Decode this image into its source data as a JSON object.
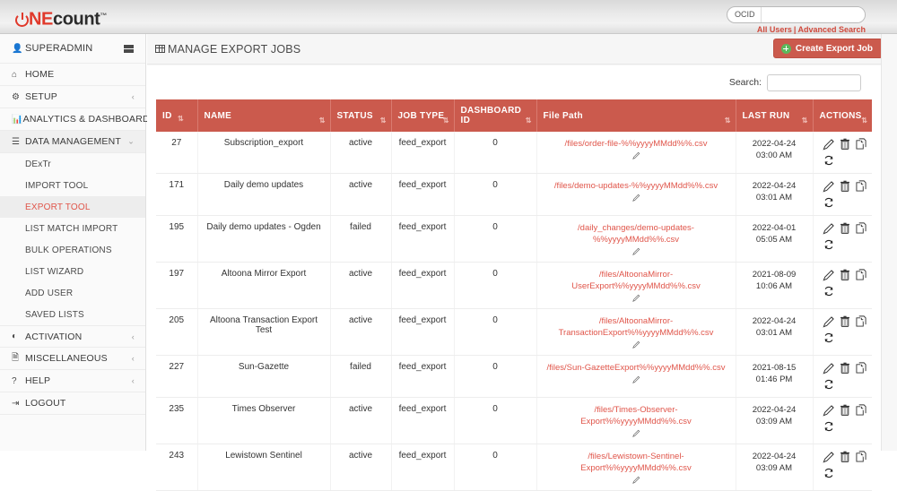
{
  "brand": {
    "logo_one": "NE",
    "logo_count": "count",
    "logo_tm": "™"
  },
  "topbar": {
    "search_label": "OCID",
    "search_value": "",
    "search_placeholder": "",
    "search_icon": "search-icon",
    "link_all_users": "All Users",
    "link_separator": "|",
    "link_advanced_search": "Advanced Search"
  },
  "sidebar": {
    "user": "SUPERADMIN",
    "items": [
      {
        "label": "HOME",
        "icon": "home-icon",
        "glyph": "⌂",
        "caret": ""
      },
      {
        "label": "SETUP",
        "icon": "gear-icon",
        "glyph": "⚙",
        "caret": "‹"
      },
      {
        "label": "ANALYTICS & DASHBOARD",
        "icon": "chart-icon",
        "glyph": "Ὄa",
        "caret": "‹"
      },
      {
        "label": "DATA MANAGEMENT",
        "icon": "database-icon",
        "glyph": "☰",
        "caret": "⌄"
      }
    ],
    "sub_items": [
      "DExTr",
      "IMPORT TOOL",
      "EXPORT TOOL",
      "LIST MATCH IMPORT",
      "BULK OPERATIONS",
      "LIST WIZARD",
      "ADD USER",
      "SAVED LISTS"
    ],
    "selected_sub": "EXPORT TOOL",
    "bottom_items": [
      {
        "label": "ACTIVATION",
        "icon": "toggle-icon",
        "glyph": "◐",
        "caret": "‹"
      },
      {
        "label": "MISCELLANEOUS",
        "icon": "file-icon",
        "glyph": "☐",
        "caret": "‹"
      },
      {
        "label": "HELP",
        "icon": "question-icon",
        "glyph": "?",
        "caret": "‹"
      },
      {
        "label": "LOGOUT",
        "icon": "logout-icon",
        "glyph": "⇥",
        "caret": ""
      }
    ]
  },
  "page": {
    "title": "MANAGE EXPORT JOBS",
    "title_icon": "table-icon",
    "create_button": "Create Export Job",
    "create_button_icon": "plus-circle-icon",
    "table_search_label": "Search:",
    "table_search_value": "",
    "table_search_placeholder": ""
  },
  "table": {
    "columns": [
      {
        "key": "id",
        "label": "ID"
      },
      {
        "key": "name",
        "label": "NAME"
      },
      {
        "key": "status",
        "label": "STATUS"
      },
      {
        "key": "job_type",
        "label": "JOB TYPE"
      },
      {
        "key": "dashboard_id",
        "label": "DASHBOARD ID"
      },
      {
        "key": "file_path",
        "label": "File Path"
      },
      {
        "key": "last_run",
        "label": "LAST RUN"
      },
      {
        "key": "actions",
        "label": "ACTIONS"
      }
    ],
    "sort_icon": "⇅",
    "row_action_icons": [
      "edit-icon",
      "delete-icon",
      "copy-icon",
      "run-icon"
    ],
    "rows": [
      {
        "id": "27",
        "name": "Subscription_export",
        "status": "active",
        "job_type": "feed_export",
        "dashboard_id": "0",
        "file_path": "/files/order-file-%%yyyyMMdd%%.csv",
        "last_run": "2022-04-24 03:00 AM"
      },
      {
        "id": "171",
        "name": "Daily demo updates",
        "status": "active",
        "job_type": "feed_export",
        "dashboard_id": "0",
        "file_path": "/files/demo-updates-%%yyyyMMdd%%.csv",
        "last_run": "2022-04-24 03:01 AM"
      },
      {
        "id": "195",
        "name": "Daily demo updates - Ogden",
        "status": "failed",
        "job_type": "feed_export",
        "dashboard_id": "0",
        "file_path": "/daily_changes/demo-updates-%%yyyyMMdd%%.csv",
        "last_run": "2022-04-01 05:05 AM"
      },
      {
        "id": "197",
        "name": "Altoona Mirror Export",
        "status": "active",
        "job_type": "feed_export",
        "dashboard_id": "0",
        "file_path": "/files/AltoonaMirror-UserExport%%yyyyMMdd%%.csv",
        "last_run": "2021-08-09 10:06 AM"
      },
      {
        "id": "205",
        "name": "Altoona Transaction Export Test",
        "status": "active",
        "job_type": "feed_export",
        "dashboard_id": "0",
        "file_path": "/files/AltoonaMirror-TransactionExport%%yyyyMMdd%%.csv",
        "last_run": "2022-04-24 03:01 AM"
      },
      {
        "id": "227",
        "name": "Sun-Gazette",
        "status": "failed",
        "job_type": "feed_export",
        "dashboard_id": "0",
        "file_path": "/files/Sun-GazetteExport%%yyyyMMdd%%.csv",
        "last_run": "2021-08-15 01:46 PM"
      },
      {
        "id": "235",
        "name": "Times Observer",
        "status": "active",
        "job_type": "feed_export",
        "dashboard_id": "0",
        "file_path": "/files/Times-Observer-Export%%yyyyMMdd%%.csv",
        "last_run": "2022-04-24 03:09 AM"
      },
      {
        "id": "243",
        "name": "Lewistown Sentinel",
        "status": "active",
        "job_type": "feed_export",
        "dashboard_id": "0",
        "file_path": "/files/Lewistown-Sentinel-Export%%yyyyMMdd%%.csv",
        "last_run": "2022-04-24 03:09 AM"
      }
    ]
  },
  "colors": {
    "accent_red": "#cb5a4d",
    "link_red": "#e0554a",
    "brand_red": "#e0392b",
    "add_green": "#5cb85c"
  }
}
